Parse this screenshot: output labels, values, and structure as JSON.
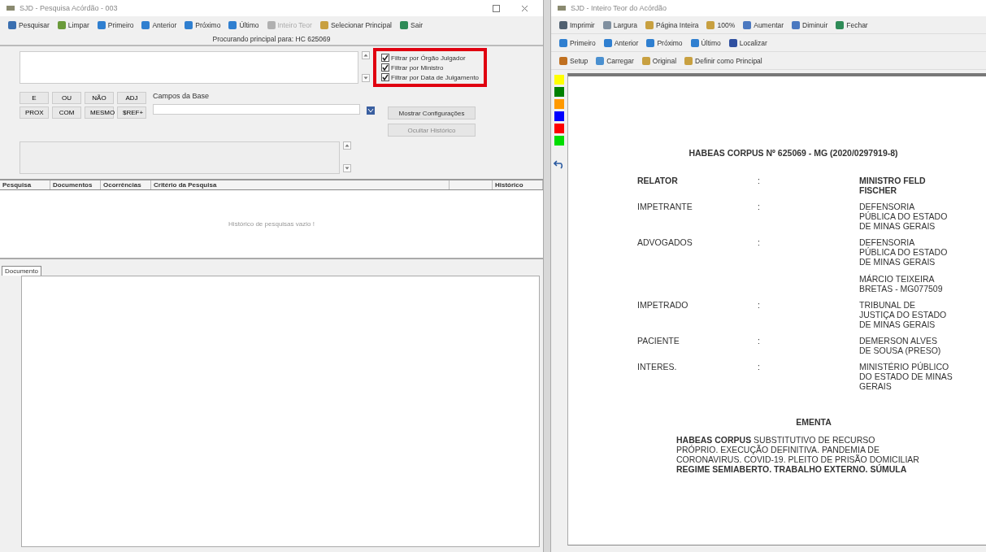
{
  "left_window": {
    "title": "SJD - Pesquisa Acórdão - 003",
    "toolbar": [
      {
        "label": "Pesquisar",
        "disabled": false
      },
      {
        "label": "Limpar",
        "disabled": false
      },
      {
        "label": "Primeiro",
        "disabled": false
      },
      {
        "label": "Anterior",
        "disabled": false
      },
      {
        "label": "Próximo",
        "disabled": false
      },
      {
        "label": "Último",
        "disabled": false
      },
      {
        "label": "Inteiro Teor",
        "disabled": true
      },
      {
        "label": "Selecionar Principal",
        "disabled": false
      },
      {
        "label": "Sair",
        "disabled": false
      }
    ],
    "subtitle": "Procurando principal para: HC 625069",
    "filters": [
      {
        "label": "Filtrar por Órgão Julgador",
        "checked": true
      },
      {
        "label": "Filtrar por Ministro",
        "checked": true
      },
      {
        "label": "Filtrar por Data de Julgamento",
        "checked": true
      }
    ],
    "operators": [
      [
        "E",
        "OU",
        "NÃO",
        "ADJ"
      ],
      [
        "PROX",
        "COM",
        "MESMO",
        "$REF+"
      ]
    ],
    "fields_label": "Campos da Base",
    "buttons": [
      {
        "label": "Mostrar Configurações",
        "disabled": false
      },
      {
        "label": "Ocultar Histórico",
        "disabled": true
      }
    ],
    "table": {
      "columns": [
        "Pesquisa",
        "Documentos",
        "Ocorrências",
        "Critério da Pesquisa",
        "Histórico"
      ],
      "empty_text": "Histórico de pesquisas vazio !"
    },
    "tabs": [
      {
        "label": "Documento",
        "selected": true
      }
    ]
  },
  "right_window": {
    "title": "SJD - Inteiro Teor do Acórdão",
    "toolbar_rows": [
      [
        {
          "label": "Imprimir"
        },
        {
          "label": "Largura"
        },
        {
          "label": "Página Inteira"
        },
        {
          "label": "100%"
        },
        {
          "label": "Aumentar"
        },
        {
          "label": "Diminuir"
        },
        {
          "label": "Fechar"
        }
      ],
      [
        {
          "label": "Primeiro"
        },
        {
          "label": "Anterior"
        },
        {
          "label": "Próximo"
        },
        {
          "label": "Último"
        },
        {
          "label": "Localizar"
        }
      ],
      [
        {
          "label": "Setup"
        },
        {
          "label": "Carregar"
        },
        {
          "label": "Original"
        },
        {
          "label": "Definir como Principal"
        }
      ]
    ],
    "highlight_colors": [
      {
        "color": "#ffff00"
      },
      {
        "color": "#008000"
      },
      {
        "color": "#ff9900"
      },
      {
        "color": "#0000ff"
      },
      {
        "color": "#ff0000"
      },
      {
        "color": "#00dd00"
      }
    ],
    "document": {
      "heading": "HABEAS CORPUS Nº 625069 - MG (2020/0297919-8)",
      "parties": [
        {
          "role": "RELATOR",
          "sep": ":",
          "bold": true,
          "value": [
            "MINISTRO FELD",
            "FISCHER"
          ]
        },
        {
          "role": "IMPETRANTE",
          "sep": ":",
          "bold": false,
          "value": [
            "DEFENSORIA",
            "PÚBLICA DO ESTADO",
            "DE MINAS GERAIS"
          ]
        },
        {
          "role": "ADVOGADOS",
          "sep": ":",
          "bold": false,
          "value": [
            "DEFENSORIA",
            "PÚBLICA DO ESTADO",
            "DE MINAS GERAIS"
          ]
        },
        {
          "bold": false,
          "value": [
            "MÁRCIO TEIXEIRA",
            "BRETAS - MG077509"
          ]
        },
        {
          "role": "IMPETRADO",
          "sep": ":",
          "bold": false,
          "value": [
            "TRIBUNAL DE",
            "JUSTIÇA DO ESTADO",
            "DE MINAS GERAIS"
          ]
        },
        {
          "role": "PACIENTE",
          "sep": ":",
          "bold": false,
          "value": [
            "DEMERSON ALVES",
            "DE SOUSA (PRESO)"
          ]
        },
        {
          "role": "INTERES.",
          "sep": ":",
          "bold": false,
          "value": [
            "MINISTÉRIO PÚBLICO",
            "DO ESTADO DE MINAS",
            "GERAIS"
          ]
        }
      ],
      "section_title": "EMENTA",
      "ementa": [
        "**HABEAS CORPUS** SUBSTITUTIVO DE RECURSO",
        "PRÓPRIO. EXECUÇÃO DEFINITIVA. PANDEMIA DE",
        "CORONAVIRUS. COVID-19. PLEITO DE PRISÃO DOMICILIAR",
        "**REGIME SEMIABERTO. TRABALHO EXTERNO. SÚMULA**"
      ]
    }
  }
}
